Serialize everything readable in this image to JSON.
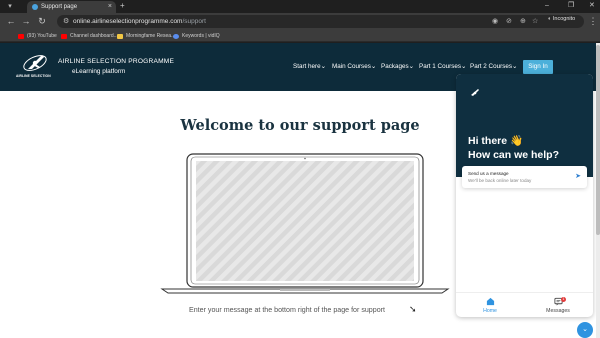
{
  "browser": {
    "tab_title": "Support page",
    "tab_close": "×",
    "new_tab": "+",
    "menu": "▾",
    "window_controls": [
      "–",
      "❐",
      "✕"
    ],
    "url_domain": "online.airlineselectionprogramme.com",
    "url_path": "/support",
    "incognito_label": "Incognito",
    "nav": {
      "back": "←",
      "forward": "→",
      "reload": "↻"
    },
    "bookmarks": [
      {
        "label": "(93) YouTube",
        "color": "#ff0000"
      },
      {
        "label": "Channel dashboard...",
        "color": "#ff0000"
      },
      {
        "label": "Morningfame Resea...",
        "color": "#f2c744"
      },
      {
        "label": "Keywords | vidIQ",
        "color": "#5a8dee"
      }
    ]
  },
  "site": {
    "logo_caption": "AIRLINE SELECTION",
    "brand_title": "AIRLINE SELECTION PROGRAMME",
    "brand_subtitle": "eLearning platform",
    "menu": [
      "Start here",
      "Main Courses",
      "Packages",
      "Part 1 Courses",
      "Part 2 Courses"
    ],
    "signin_label": "Sign In",
    "colors": {
      "header_bg": "#0d2b3a",
      "accent": "#4cb0da"
    }
  },
  "main": {
    "heading": "Welcome to our support page",
    "instruction": "Enter your message at the bottom right of the page for support",
    "instruction_arrow": "➘"
  },
  "chat": {
    "greeting": "Hi there 👋",
    "question": "How can we help?",
    "card_title": "Send us a message",
    "card_subtitle": "We'll be back online later today",
    "tabs": [
      {
        "label": "Home",
        "icon": "home-icon",
        "active": true
      },
      {
        "label": "Messages",
        "icon": "messages-icon",
        "active": false,
        "badge": "1"
      }
    ],
    "launcher_icon": "chevron-down-icon"
  }
}
